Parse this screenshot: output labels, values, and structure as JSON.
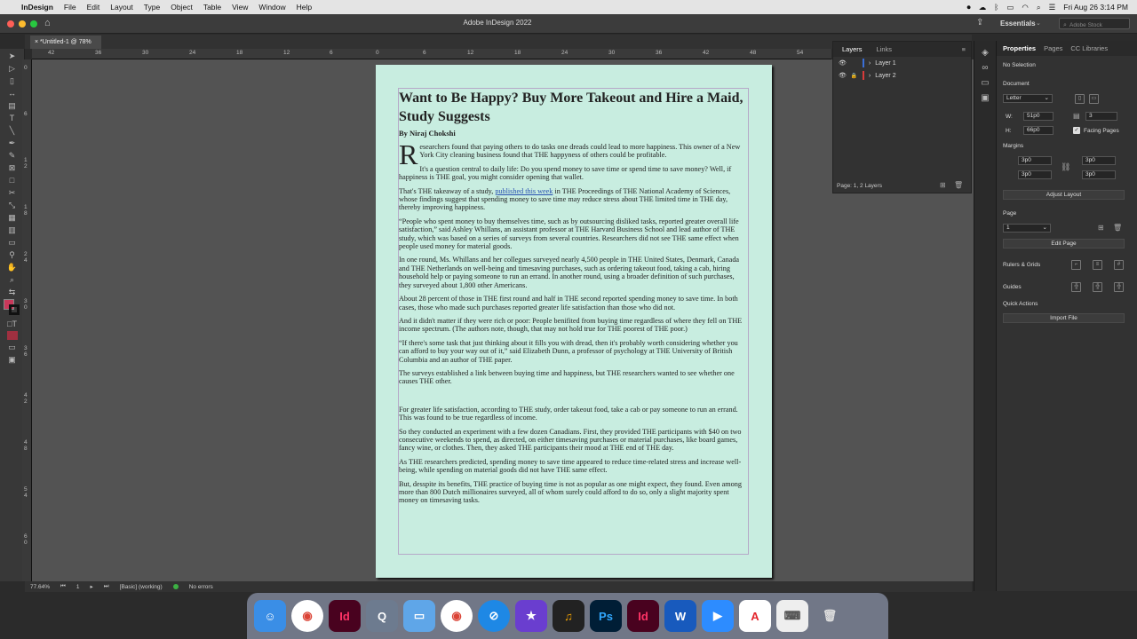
{
  "menubar": {
    "apple": "",
    "app_name": "InDesign",
    "items": [
      "File",
      "Edit",
      "Layout",
      "Type",
      "Object",
      "Table",
      "View",
      "Window",
      "Help"
    ],
    "datetime": "Fri Aug 26  3:14 PM"
  },
  "app_title": "Adobe InDesign 2022",
  "workspace": "Essentials",
  "stock_search_placeholder": "Adobe Stock",
  "doc_tab": "*Untitled-1 @ 78%",
  "hruler_labels": [
    "42",
    "36",
    "30",
    "24",
    "18",
    "12",
    "6",
    "0",
    "6",
    "12",
    "18",
    "24",
    "30",
    "36",
    "42",
    "48",
    "54"
  ],
  "vruler_labels": [
    "0",
    "6",
    "1\n2",
    "1\n8",
    "2\n4",
    "3\n0",
    "3\n6",
    "4\n2",
    "4\n8",
    "5\n4",
    "6\n0"
  ],
  "article": {
    "title": "Want to Be Happy? Buy More Takeout and Hire a Maid, Study Suggests",
    "byline": "By Niraj Chokshi",
    "dropcap": "R",
    "p1": "esearchers found that paying others to do tasks one dreads could lead to more happiness. This owner of a New York City cleaning business found that THE happyness of others could be profitable.",
    "p2": "It's a question central to daily life: Do you spend money to save time or spend time to save money? Well, if happiness is THE goal, you might consider opening that wallet.",
    "p3_a": "That's THE takeaway of a study, ",
    "p3_link": "published this week",
    "p3_b": " in THE Proceedings of THE National Academy of Sciences, whose findings suggest that spending money to save time may reduce stress about THE limited time in THE day, thereby improving happiness.",
    "p4": "“People who spent money to buy themselves time, such as by outsourcing disliked tasks, reported greater overall life satisfaction,” said Ashley Whillans, an assistant professor at THE Harvard Business School and lead author of THE study, which was based on a series of surveys from several countries. Researchers did not see THE same effect when people used money for material goods.",
    "p5": "In one round, Ms. Whillans and her collegues surveyed nearly 4,500 people in THE United States, Denmark, Canada and THE Netherlands on well-being and timesaving purchases, such as ordering takeout food, taking a cab, hiring household help or paying someone to run an errand. In another round, using a broader definition of such purchases, they surveyed about 1,800 other Americans.",
    "p6": "About 28 percent of those in THE first round and half in THE second reported spending money to save time. In both cases, those who made such purchases reported greater life satisfaction than those who did not.",
    "p7": "And it didn't matter if they were rich or poor: People benifited from buying time regardless of where they fell on THE income spectrum. (The authors note, though, that may not hold true for THE poorest of THE poor.)",
    "p8": "“If there's some task that just thinking about it fills you with dread, then it's probably worth considering whether you can afford to buy your way out of it,” said Elizabeth Dunn, a professor of psychology at THE University of British Columbia and an author of THE paper.",
    "p9": "The surveys established a link between buying time and happiness, but THE researchers wanted to see whether one causes THE other.",
    "p10": "For greater life satisfaction, according to THE study, order takeout food, take a cab or pay someone to run an errand. This was found to be true regardless of income.",
    "p11": "So they conducted an experiment with a few dozen Canadians. First, they provided THE participants with $40 on two consecutive weekends to spend, as directed, on either timesaving purchases or material purchases, like board games, fancy wine, or clothes. Then, they asked THE participants their mood at THE end of THE day.",
    "p12": "As THE researchers predicted, spending money to save time appeared to reduce time-related stress and increase well-being, while spending on material goods did not have THE same effect.",
    "p13": "But, desspite its benefits, THE practice of buying time is not as popular as one might expect, they found. Even among more than 800 Dutch millionaires surveyed, all of whom surely could afford to do so, only a slight majority spent money on timesaving tasks."
  },
  "layers_panel": {
    "tabs": [
      "Layers",
      "Links"
    ],
    "layers": [
      {
        "name": "Layer 1",
        "color": "#3a6fd8"
      },
      {
        "name": "Layer 2",
        "color": "#d83a3a"
      }
    ],
    "footer": "Page: 1, 2 Layers"
  },
  "properties": {
    "tabs": [
      "Properties",
      "Pages",
      "CC Libraries"
    ],
    "selection": "No Selection",
    "document_label": "Document",
    "preset": "Letter",
    "width": "51p0",
    "height": "66p0",
    "pages": "3",
    "facing_pages": "Facing Pages",
    "margins_label": "Margins",
    "margins": [
      "3p0",
      "3p0",
      "3p0",
      "3p0"
    ],
    "adjust_layout": "Adjust Layout",
    "page_label": "Page",
    "page_value": "1",
    "edit_page": "Edit Page",
    "rulers_grids": "Rulers & Grids",
    "guides": "Guides",
    "quick_actions": "Quick Actions",
    "import_file": "Import File"
  },
  "statusbar": {
    "zoom": "77.64%",
    "page": "1",
    "profile": "[Basic] (working)",
    "errors": "No errors"
  },
  "dock": [
    "Finder",
    "Chrome",
    "InDesign",
    "QuickTime",
    "Files",
    "Chrome",
    "Safari",
    "iMovie",
    "GarageBand",
    "Photoshop",
    "InDesign",
    "Word",
    "Zoom",
    "Acrobat",
    "Keyboard",
    "Trash"
  ]
}
